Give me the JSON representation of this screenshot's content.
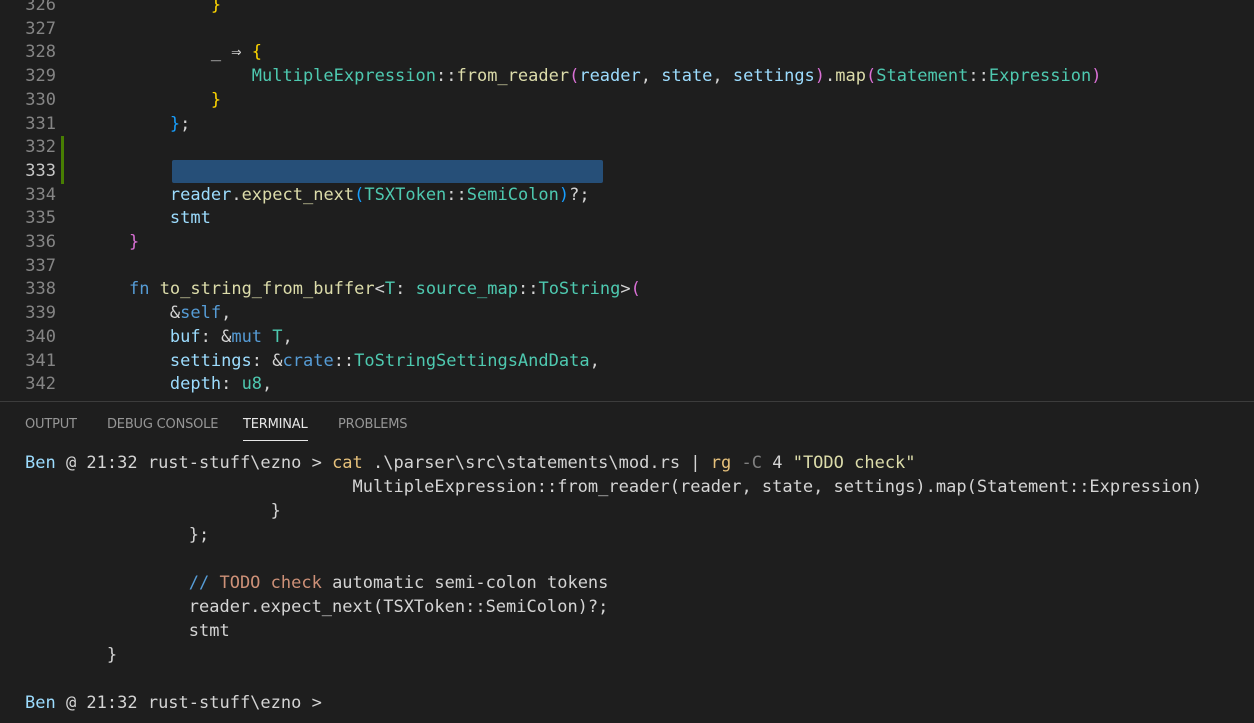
{
  "editor": {
    "lines": [
      {
        "n": "326",
        "segments": [
          {
            "t": "            ",
            "c": "plain"
          },
          {
            "t": "}",
            "c": "b1"
          }
        ]
      },
      {
        "n": "327",
        "segments": []
      },
      {
        "n": "328",
        "segments": [
          {
            "t": "            ",
            "c": "plain"
          },
          {
            "t": "_ ⇒ ",
            "c": "plain"
          },
          {
            "t": "{",
            "c": "b1"
          }
        ]
      },
      {
        "n": "329",
        "segments": [
          {
            "t": "                ",
            "c": "plain"
          },
          {
            "t": "MultipleExpression",
            "c": "type"
          },
          {
            "t": "::",
            "c": "plain"
          },
          {
            "t": "from_reader",
            "c": "fn"
          },
          {
            "t": "(",
            "c": "b2"
          },
          {
            "t": "reader",
            "c": "var"
          },
          {
            "t": ", ",
            "c": "plain"
          },
          {
            "t": "state",
            "c": "var"
          },
          {
            "t": ", ",
            "c": "plain"
          },
          {
            "t": "settings",
            "c": "var"
          },
          {
            "t": ")",
            "c": "b2"
          },
          {
            "t": ".",
            "c": "plain"
          },
          {
            "t": "map",
            "c": "fn"
          },
          {
            "t": "(",
            "c": "b2"
          },
          {
            "t": "Statement",
            "c": "type"
          },
          {
            "t": "::",
            "c": "plain"
          },
          {
            "t": "Expression",
            "c": "type"
          },
          {
            "t": ")",
            "c": "b2"
          }
        ]
      },
      {
        "n": "330",
        "segments": [
          {
            "t": "            ",
            "c": "plain"
          },
          {
            "t": "}",
            "c": "b1"
          }
        ]
      },
      {
        "n": "331",
        "segments": [
          {
            "t": "        ",
            "c": "plain"
          },
          {
            "t": "}",
            "c": "b3"
          },
          {
            "t": ";",
            "c": "plain"
          }
        ]
      },
      {
        "n": "332",
        "segments": []
      },
      {
        "n": "333",
        "segments": [],
        "active": true
      },
      {
        "n": "334",
        "segments": [
          {
            "t": "        ",
            "c": "plain"
          },
          {
            "t": "reader",
            "c": "var"
          },
          {
            "t": ".",
            "c": "plain"
          },
          {
            "t": "expect_next",
            "c": "fn"
          },
          {
            "t": "(",
            "c": "b3"
          },
          {
            "t": "TSXToken",
            "c": "type"
          },
          {
            "t": "::",
            "c": "plain"
          },
          {
            "t": "SemiColon",
            "c": "type"
          },
          {
            "t": ")",
            "c": "b3"
          },
          {
            "t": "?;",
            "c": "plain"
          }
        ]
      },
      {
        "n": "335",
        "segments": [
          {
            "t": "        ",
            "c": "plain"
          },
          {
            "t": "stmt",
            "c": "var"
          }
        ]
      },
      {
        "n": "336",
        "segments": [
          {
            "t": "    ",
            "c": "plain"
          },
          {
            "t": "}",
            "c": "b2"
          }
        ]
      },
      {
        "n": "337",
        "segments": []
      },
      {
        "n": "338",
        "segments": [
          {
            "t": "    ",
            "c": "plain"
          },
          {
            "t": "fn",
            "c": "kw"
          },
          {
            "t": " ",
            "c": "plain"
          },
          {
            "t": "to_string_from_buffer",
            "c": "fn"
          },
          {
            "t": "<",
            "c": "plain"
          },
          {
            "t": "T",
            "c": "type"
          },
          {
            "t": ": ",
            "c": "plain"
          },
          {
            "t": "source_map",
            "c": "type"
          },
          {
            "t": "::",
            "c": "plain"
          },
          {
            "t": "ToString",
            "c": "type"
          },
          {
            "t": ">",
            "c": "plain"
          },
          {
            "t": "(",
            "c": "b2"
          }
        ]
      },
      {
        "n": "339",
        "segments": [
          {
            "t": "        ",
            "c": "plain"
          },
          {
            "t": "&",
            "c": "plain"
          },
          {
            "t": "self",
            "c": "kw"
          },
          {
            "t": ",",
            "c": "plain"
          }
        ]
      },
      {
        "n": "340",
        "segments": [
          {
            "t": "        ",
            "c": "plain"
          },
          {
            "t": "buf",
            "c": "var"
          },
          {
            "t": ": &",
            "c": "plain"
          },
          {
            "t": "mut",
            "c": "kw"
          },
          {
            "t": " ",
            "c": "plain"
          },
          {
            "t": "T",
            "c": "type"
          },
          {
            "t": ",",
            "c": "plain"
          }
        ]
      },
      {
        "n": "341",
        "segments": [
          {
            "t": "        ",
            "c": "plain"
          },
          {
            "t": "settings",
            "c": "var"
          },
          {
            "t": ": &",
            "c": "plain"
          },
          {
            "t": "crate",
            "c": "kw"
          },
          {
            "t": "::",
            "c": "plain"
          },
          {
            "t": "ToStringSettingsAndData",
            "c": "type"
          },
          {
            "t": ",",
            "c": "plain"
          }
        ]
      },
      {
        "n": "342",
        "segments": [
          {
            "t": "        ",
            "c": "plain"
          },
          {
            "t": "depth",
            "c": "var"
          },
          {
            "t": ": ",
            "c": "plain"
          },
          {
            "t": "u8",
            "c": "type"
          },
          {
            "t": ",",
            "c": "plain"
          }
        ]
      }
    ]
  },
  "panel": {
    "tabs": [
      {
        "label": "OUTPUT",
        "active": false
      },
      {
        "label": "DEBUG CONSOLE",
        "active": false
      },
      {
        "label": "TERMINAL",
        "active": true
      },
      {
        "label": "PROBLEMS",
        "active": false
      }
    ]
  },
  "terminal": {
    "lines": [
      {
        "segments": [
          {
            "t": "Ben",
            "c": "t-user"
          },
          {
            "t": " @ 21:32 rust-stuff\\ezno > ",
            "c": "plain"
          },
          {
            "t": "cat",
            "c": "t-cmd"
          },
          {
            "t": " .\\parser\\src\\statements\\mod.rs | ",
            "c": "plain"
          },
          {
            "t": "rg",
            "c": "t-cmd"
          },
          {
            "t": " -C ",
            "c": "t-dim"
          },
          {
            "t": "4",
            "c": "plain"
          },
          {
            "t": " \"TODO check\"",
            "c": "t-str"
          }
        ]
      },
      {
        "segments": [
          {
            "t": "                                MultipleExpression::from_reader(reader, state, settings).map(Statement::Expression)",
            "c": "plain"
          }
        ]
      },
      {
        "segments": [
          {
            "t": "                        }",
            "c": "plain"
          }
        ]
      },
      {
        "segments": [
          {
            "t": "                };",
            "c": "plain"
          }
        ]
      },
      {
        "segments": []
      },
      {
        "segments": [
          {
            "t": "                // ",
            "c": "kw"
          },
          {
            "t": "TODO check",
            "c": "t-hl"
          },
          {
            "t": " automatic semi-colon tokens",
            "c": "t-comment"
          }
        ]
      },
      {
        "segments": [
          {
            "t": "                reader.expect_next(TSXToken::SemiColon)?;",
            "c": "plain"
          }
        ]
      },
      {
        "segments": [
          {
            "t": "                stmt",
            "c": "plain"
          }
        ]
      },
      {
        "segments": [
          {
            "t": "        }",
            "c": "plain"
          }
        ]
      },
      {
        "segments": []
      },
      {
        "segments": [
          {
            "t": "Ben",
            "c": "t-user"
          },
          {
            "t": " @ 21:32 rust-stuff\\ezno >",
            "c": "plain"
          }
        ]
      }
    ]
  }
}
